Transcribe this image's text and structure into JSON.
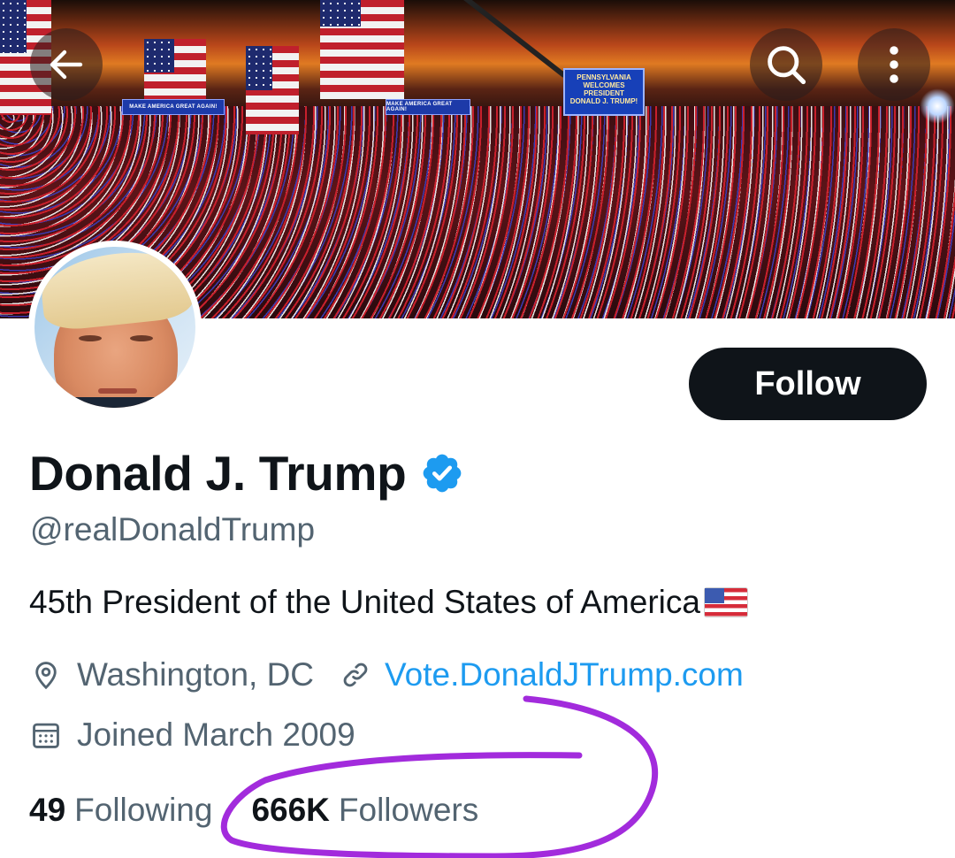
{
  "header": {
    "back_icon": "arrow-left-icon",
    "search_icon": "search-icon",
    "more_icon": "more-vertical-icon",
    "banner": {
      "stage_sign_lines": [
        "PENNSYLVANIA",
        "WELCOMES",
        "PRESIDENT",
        "DONALD J. TRUMP!"
      ],
      "small_banner_text": "MAKE AMERICA GREAT AGAIN!"
    }
  },
  "profile": {
    "display_name": "Donald J. Trump",
    "verified_icon": "verified-badge-icon",
    "handle": "@realDonaldTrump",
    "bio": "45th President of the United States of America",
    "bio_emoji": "us-flag-emoji",
    "location_icon": "location-pin-icon",
    "location": "Washington, DC",
    "link_icon": "link-icon",
    "website": "Vote.DonaldJTrump.com",
    "calendar_icon": "calendar-icon",
    "joined": "Joined March 2009"
  },
  "actions": {
    "follow_label": "Follow"
  },
  "stats": {
    "following_count": "49",
    "following_label": "Following",
    "followers_count": "666K",
    "followers_label": "Followers"
  },
  "colors": {
    "text_primary": "#0f1419",
    "text_secondary": "#536471",
    "link": "#1d9bf0",
    "verified": "#1d9bf0",
    "follow_button_bg": "#0f1419",
    "annotation_stroke": "#a22bdc"
  }
}
